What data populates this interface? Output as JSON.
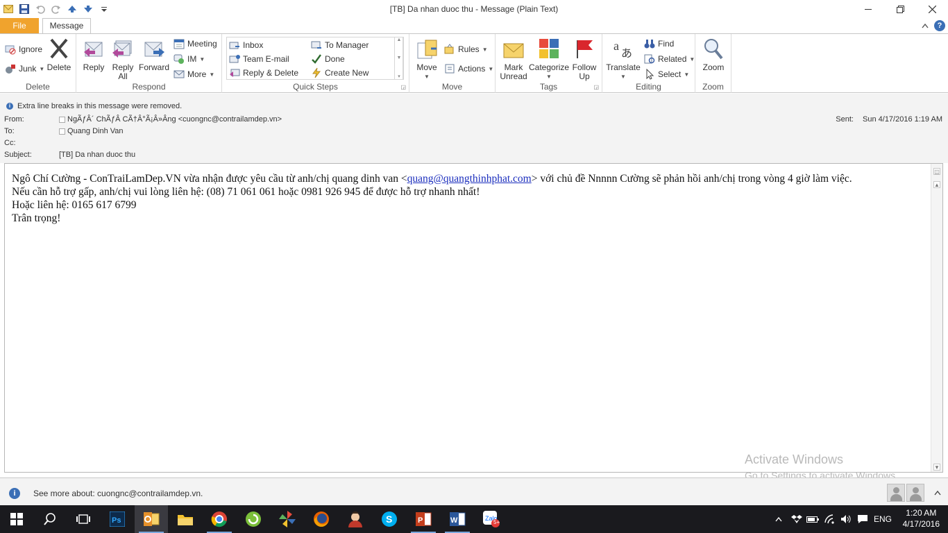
{
  "window": {
    "title": "[TB] Da nhan duoc thu  -  Message (Plain Text)"
  },
  "tabs": {
    "file": "File",
    "message": "Message"
  },
  "ribbon": {
    "delete_group": {
      "label": "Delete",
      "ignore": "Ignore",
      "junk": "Junk",
      "delete": "Delete"
    },
    "respond_group": {
      "label": "Respond",
      "reply": "Reply",
      "reply_all_1": "Reply",
      "reply_all_2": "All",
      "forward": "Forward",
      "meeting": "Meeting",
      "im": "IM",
      "more": "More"
    },
    "quicksteps_group": {
      "label": "Quick Steps",
      "items": [
        "Inbox",
        "To Manager",
        "Team E-mail",
        "Done",
        "Reply & Delete",
        "Create New"
      ]
    },
    "move_group": {
      "label": "Move",
      "move": "Move",
      "rules": "Rules",
      "actions": "Actions"
    },
    "tags_group": {
      "label": "Tags",
      "mark_unread_1": "Mark",
      "mark_unread_2": "Unread",
      "categorize": "Categorize",
      "follow_up_1": "Follow",
      "follow_up_2": "Up"
    },
    "editing_group": {
      "label": "Editing",
      "translate": "Translate",
      "find": "Find",
      "related": "Related",
      "select": "Select"
    },
    "zoom_group": {
      "label": "Zoom",
      "zoom": "Zoom"
    }
  },
  "header": {
    "notice": "Extra line breaks in this message were removed.",
    "from_label": "From:",
    "from_value": "NgÃƒÂ´ ChÃƒÂ­ CÃ†Â°Ã¡Â»Âng <cuongnc@contrailamdep.vn>",
    "to_label": "To:",
    "to_value": "Quang Dinh Van",
    "cc_label": "Cc:",
    "subject_label": "Subject:",
    "subject_value": "[TB] Da nhan duoc thu",
    "sent_label": "Sent:",
    "sent_value": "Sun 4/17/2016 1:19 AM"
  },
  "body": {
    "line1_pre": "Ngô Chí Cường  - ConTraiLamDep.VN vừa nhận được yêu cầu từ anh/chị quang dinh van <",
    "line1_link": "quang@quangthinhphat.com",
    "line1_post": "> với chủ đề Nnnnn Cường sẽ phản hồi anh/chị trong vòng 4 giờ làm việc.",
    "line2": "Nếu cần hỗ trợ gấp, anh/chị vui lòng liên hệ: (08) 71 061 061 hoặc 0981 926 945 để được hỗ trợ nhanh nhất!",
    "line3": "Hoặc liên hệ: 0165 617 6799",
    "line4": "Trân trọng!"
  },
  "watermark": {
    "line1": "Activate Windows",
    "line2": "Go to Settings to activate Windows."
  },
  "people_pane": {
    "text": "See more about: cuongnc@contrailamdep.vn."
  },
  "taskbar": {
    "apps": [
      "start-icon",
      "search-icon",
      "task-view-icon",
      "photoshop-icon",
      "outlook-icon",
      "file-explorer-icon",
      "chrome-icon",
      "app-green-icon",
      "app-pinwheel-icon",
      "firefox-icon",
      "app-avatar-icon",
      "skype-icon",
      "powerpoint-icon",
      "word-icon",
      "zalo-icon"
    ],
    "language": "ENG",
    "time": "1:20 AM",
    "date": "4/17/2016",
    "zalo_badge": "5+"
  },
  "colors": {
    "file_tab": "#f0a32d",
    "link": "#1a2dbd",
    "taskbar": "#1a1a1e"
  }
}
